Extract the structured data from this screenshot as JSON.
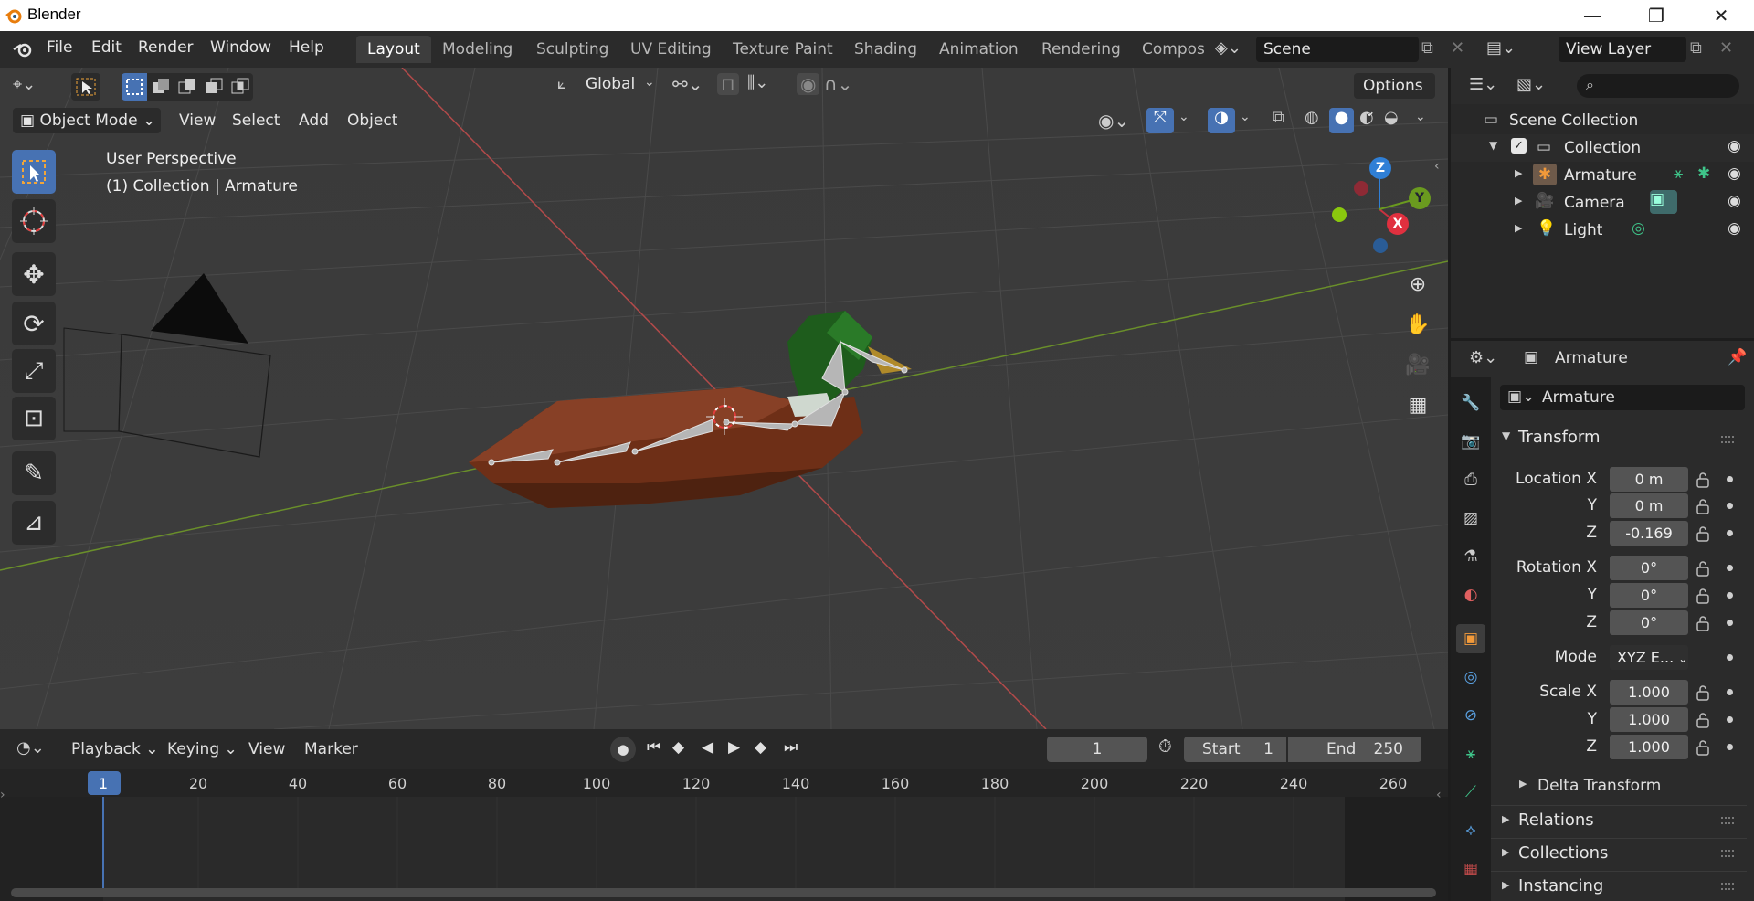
{
  "os": {
    "title": "Blender",
    "minimize": "—",
    "restore": "❐",
    "close": "✕"
  },
  "menu": [
    "File",
    "Edit",
    "Render",
    "Window",
    "Help"
  ],
  "workspaces": [
    "Layout",
    "Modeling",
    "Sculpting",
    "UV Editing",
    "Texture Paint",
    "Shading",
    "Animation",
    "Rendering",
    "Compos"
  ],
  "scene": {
    "name": "Scene",
    "view_layer": "View Layer"
  },
  "toolheader": {
    "orientation": "Global",
    "options": "Options"
  },
  "viewport_header": {
    "mode": "Object Mode",
    "menus": [
      "View",
      "Select",
      "Add",
      "Object"
    ]
  },
  "viewport": {
    "perspective": "User Perspective",
    "context": "(1) Collection | Armature",
    "gizmo": {
      "z": "Z",
      "y": "Y",
      "x": "X"
    }
  },
  "timeline": {
    "menus": [
      "Playback",
      "Keying",
      "View",
      "Marker"
    ],
    "current_frame": "1",
    "start_label": "Start",
    "start": "1",
    "end_label": "End",
    "end": "250",
    "ruler": [
      "1",
      "20",
      "40",
      "60",
      "80",
      "100",
      "120",
      "140",
      "160",
      "180",
      "200",
      "220",
      "240",
      "260"
    ]
  },
  "outliner": {
    "scene_collection": "Scene Collection",
    "collection": "Collection",
    "items": [
      "Armature",
      "Camera",
      "Light"
    ]
  },
  "properties": {
    "object_name": "Armature",
    "data_name": "Armature",
    "transform_title": "Transform",
    "location_label": "Location X",
    "y_label": "Y",
    "z_label": "Z",
    "location": [
      "0 m",
      "0 m",
      "-0.169"
    ],
    "rotation_label": "Rotation X",
    "rotation": [
      "0°",
      "0°",
      "0°"
    ],
    "mode_label": "Mode",
    "mode": "XYZ E...",
    "scale_label": "Scale X",
    "scale": [
      "1.000",
      "1.000",
      "1.000"
    ],
    "delta": "Delta Transform",
    "sections": [
      "Relations",
      "Collections",
      "Instancing"
    ]
  },
  "colors": {
    "accent": "#4772b3",
    "x_axis": "#c8323f",
    "y_axis": "#6a9a1f",
    "z_axis": "#2f7fd6",
    "active_object": "#f29a3a"
  }
}
